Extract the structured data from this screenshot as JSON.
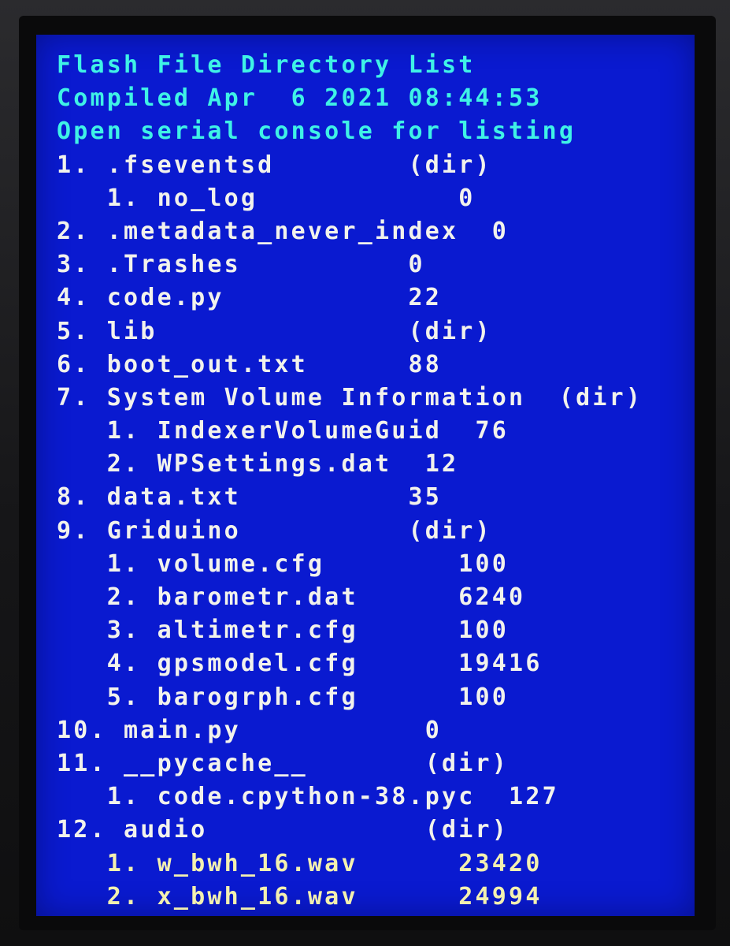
{
  "header": {
    "title": "Flash File Directory List",
    "compiled": "Compiled Apr  6 2021 08:44:53",
    "hint": "Open serial console for listing"
  },
  "listing": [
    "1. .fseventsd        (dir)",
    "   1. no_log            0",
    "2. .metadata_never_index  0",
    "3. .Trashes          0",
    "4. code.py           22",
    "5. lib               (dir)",
    "6. boot_out.txt      88",
    "7. System Volume Information  (dir)",
    "   1. IndexerVolumeGuid  76",
    "   2. WPSettings.dat  12",
    "8. data.txt          35",
    "9. Griduino          (dir)",
    "   1. volume.cfg        100",
    "   2. barometr.dat      6240",
    "   3. altimetr.cfg      100",
    "   4. gpsmodel.cfg      19416",
    "   5. barogrph.cfg      100",
    "10. main.py           0",
    "11. __pycache__       (dir)",
    "   1. code.cpython-38.pyc  127",
    "12. audio             (dir)",
    "   1. w_bwh_16.wav      23420",
    "   2. x_bwh_16.wav      24994"
  ],
  "colors": {
    "screen_background": "#0a1ad0",
    "header_text": "#3ff2e6",
    "listing_text": "#f2f2ec",
    "bezel": "#161618"
  }
}
